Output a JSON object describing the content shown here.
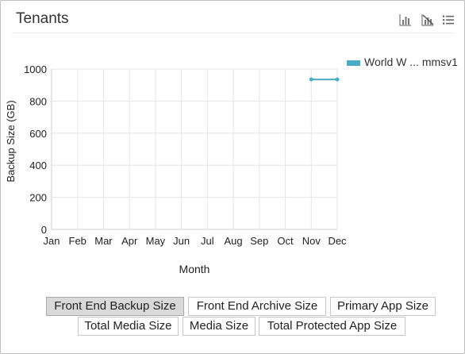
{
  "header": {
    "title": "Tenants"
  },
  "toolbar": {
    "icons": [
      "bar-chart-icon",
      "clear-chart-icon",
      "list-view-icon"
    ]
  },
  "chart_data": {
    "type": "line",
    "title": "",
    "xlabel": "Month",
    "ylabel": "Backup Size (GB)",
    "categories": [
      "Jan",
      "Feb",
      "Mar",
      "Apr",
      "May",
      "Jun",
      "Jul",
      "Aug",
      "Sep",
      "Oct",
      "Nov",
      "Dec"
    ],
    "ylim": [
      0,
      1000
    ],
    "yticks": [
      0,
      200,
      400,
      600,
      800,
      1000
    ],
    "grid": true,
    "legend_position": "top-right",
    "series": [
      {
        "name": "World W ... mmsv1",
        "color": "#4bacc6",
        "values": [
          null,
          null,
          null,
          null,
          null,
          null,
          null,
          null,
          null,
          null,
          935,
          935
        ]
      }
    ]
  },
  "metric_buttons": [
    {
      "label": "Front End Backup Size",
      "active": true
    },
    {
      "label": "Front End Archive Size",
      "active": false
    },
    {
      "label": "Primary App Size",
      "active": false
    },
    {
      "label": "Total Media Size",
      "active": false
    },
    {
      "label": "Media Size",
      "active": false
    },
    {
      "label": "Total Protected App Size",
      "active": false
    }
  ]
}
